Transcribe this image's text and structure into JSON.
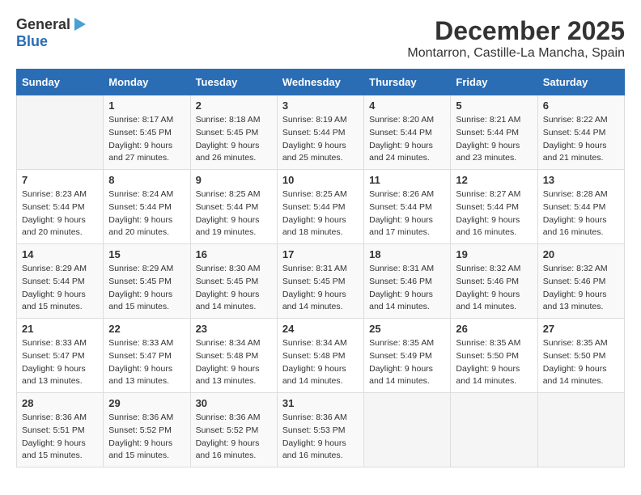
{
  "logo": {
    "general": "General",
    "blue": "Blue"
  },
  "title": "December 2025",
  "location": "Montarron, Castille-La Mancha, Spain",
  "days_header": [
    "Sunday",
    "Monday",
    "Tuesday",
    "Wednesday",
    "Thursday",
    "Friday",
    "Saturday"
  ],
  "weeks": [
    [
      {
        "num": "",
        "info": ""
      },
      {
        "num": "1",
        "info": "Sunrise: 8:17 AM\nSunset: 5:45 PM\nDaylight: 9 hours\nand 27 minutes."
      },
      {
        "num": "2",
        "info": "Sunrise: 8:18 AM\nSunset: 5:45 PM\nDaylight: 9 hours\nand 26 minutes."
      },
      {
        "num": "3",
        "info": "Sunrise: 8:19 AM\nSunset: 5:44 PM\nDaylight: 9 hours\nand 25 minutes."
      },
      {
        "num": "4",
        "info": "Sunrise: 8:20 AM\nSunset: 5:44 PM\nDaylight: 9 hours\nand 24 minutes."
      },
      {
        "num": "5",
        "info": "Sunrise: 8:21 AM\nSunset: 5:44 PM\nDaylight: 9 hours\nand 23 minutes."
      },
      {
        "num": "6",
        "info": "Sunrise: 8:22 AM\nSunset: 5:44 PM\nDaylight: 9 hours\nand 21 minutes."
      }
    ],
    [
      {
        "num": "7",
        "info": "Sunrise: 8:23 AM\nSunset: 5:44 PM\nDaylight: 9 hours\nand 20 minutes."
      },
      {
        "num": "8",
        "info": "Sunrise: 8:24 AM\nSunset: 5:44 PM\nDaylight: 9 hours\nand 20 minutes."
      },
      {
        "num": "9",
        "info": "Sunrise: 8:25 AM\nSunset: 5:44 PM\nDaylight: 9 hours\nand 19 minutes."
      },
      {
        "num": "10",
        "info": "Sunrise: 8:25 AM\nSunset: 5:44 PM\nDaylight: 9 hours\nand 18 minutes."
      },
      {
        "num": "11",
        "info": "Sunrise: 8:26 AM\nSunset: 5:44 PM\nDaylight: 9 hours\nand 17 minutes."
      },
      {
        "num": "12",
        "info": "Sunrise: 8:27 AM\nSunset: 5:44 PM\nDaylight: 9 hours\nand 16 minutes."
      },
      {
        "num": "13",
        "info": "Sunrise: 8:28 AM\nSunset: 5:44 PM\nDaylight: 9 hours\nand 16 minutes."
      }
    ],
    [
      {
        "num": "14",
        "info": "Sunrise: 8:29 AM\nSunset: 5:44 PM\nDaylight: 9 hours\nand 15 minutes."
      },
      {
        "num": "15",
        "info": "Sunrise: 8:29 AM\nSunset: 5:45 PM\nDaylight: 9 hours\nand 15 minutes."
      },
      {
        "num": "16",
        "info": "Sunrise: 8:30 AM\nSunset: 5:45 PM\nDaylight: 9 hours\nand 14 minutes."
      },
      {
        "num": "17",
        "info": "Sunrise: 8:31 AM\nSunset: 5:45 PM\nDaylight: 9 hours\nand 14 minutes."
      },
      {
        "num": "18",
        "info": "Sunrise: 8:31 AM\nSunset: 5:46 PM\nDaylight: 9 hours\nand 14 minutes."
      },
      {
        "num": "19",
        "info": "Sunrise: 8:32 AM\nSunset: 5:46 PM\nDaylight: 9 hours\nand 14 minutes."
      },
      {
        "num": "20",
        "info": "Sunrise: 8:32 AM\nSunset: 5:46 PM\nDaylight: 9 hours\nand 13 minutes."
      }
    ],
    [
      {
        "num": "21",
        "info": "Sunrise: 8:33 AM\nSunset: 5:47 PM\nDaylight: 9 hours\nand 13 minutes."
      },
      {
        "num": "22",
        "info": "Sunrise: 8:33 AM\nSunset: 5:47 PM\nDaylight: 9 hours\nand 13 minutes."
      },
      {
        "num": "23",
        "info": "Sunrise: 8:34 AM\nSunset: 5:48 PM\nDaylight: 9 hours\nand 13 minutes."
      },
      {
        "num": "24",
        "info": "Sunrise: 8:34 AM\nSunset: 5:48 PM\nDaylight: 9 hours\nand 14 minutes."
      },
      {
        "num": "25",
        "info": "Sunrise: 8:35 AM\nSunset: 5:49 PM\nDaylight: 9 hours\nand 14 minutes."
      },
      {
        "num": "26",
        "info": "Sunrise: 8:35 AM\nSunset: 5:50 PM\nDaylight: 9 hours\nand 14 minutes."
      },
      {
        "num": "27",
        "info": "Sunrise: 8:35 AM\nSunset: 5:50 PM\nDaylight: 9 hours\nand 14 minutes."
      }
    ],
    [
      {
        "num": "28",
        "info": "Sunrise: 8:36 AM\nSunset: 5:51 PM\nDaylight: 9 hours\nand 15 minutes."
      },
      {
        "num": "29",
        "info": "Sunrise: 8:36 AM\nSunset: 5:52 PM\nDaylight: 9 hours\nand 15 minutes."
      },
      {
        "num": "30",
        "info": "Sunrise: 8:36 AM\nSunset: 5:52 PM\nDaylight: 9 hours\nand 16 minutes."
      },
      {
        "num": "31",
        "info": "Sunrise: 8:36 AM\nSunset: 5:53 PM\nDaylight: 9 hours\nand 16 minutes."
      },
      {
        "num": "",
        "info": ""
      },
      {
        "num": "",
        "info": ""
      },
      {
        "num": "",
        "info": ""
      }
    ]
  ]
}
